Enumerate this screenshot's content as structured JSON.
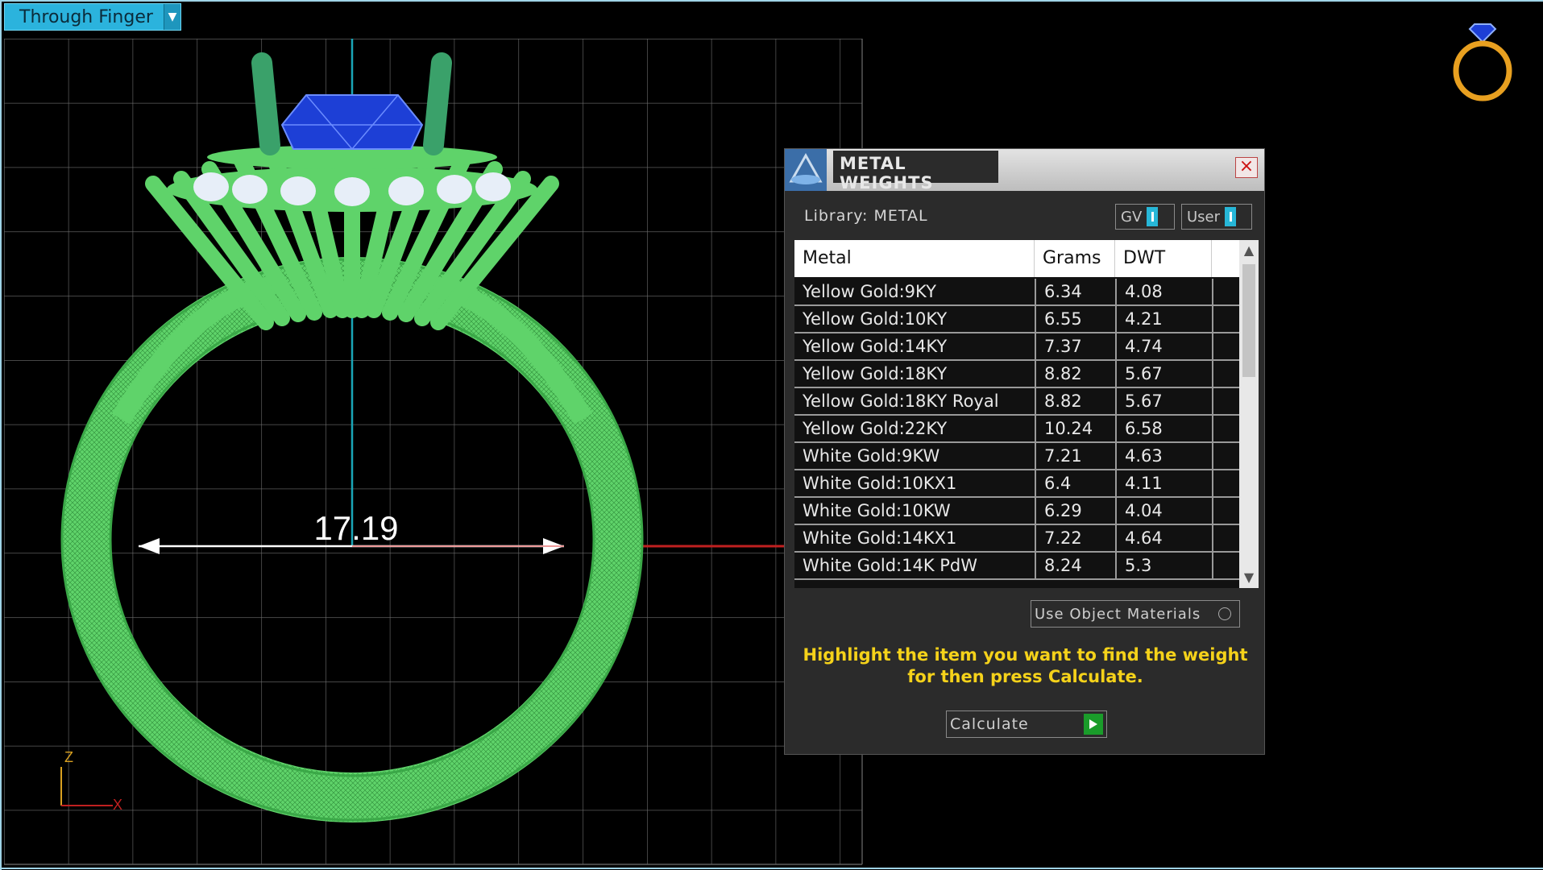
{
  "view": {
    "mode_label": "Through Finger",
    "measurement": "17.19",
    "axis_z": "Z",
    "axis_x": "X"
  },
  "panel": {
    "title": "METAL WEIGHTS",
    "library_label": "Library: METAL",
    "toggle_gv": "GV",
    "toggle_user": "User",
    "columns": [
      "Metal",
      "Grams",
      "DWT"
    ],
    "rows": [
      {
        "metal": "Yellow Gold:9KY",
        "grams": "6.34",
        "dwt": "4.08"
      },
      {
        "metal": "Yellow Gold:10KY",
        "grams": "6.55",
        "dwt": "4.21"
      },
      {
        "metal": "Yellow Gold:14KY",
        "grams": "7.37",
        "dwt": "4.74"
      },
      {
        "metal": "Yellow Gold:18KY",
        "grams": "8.82",
        "dwt": "5.67"
      },
      {
        "metal": "Yellow Gold:18KY Royal",
        "grams": "8.82",
        "dwt": "5.67"
      },
      {
        "metal": "Yellow Gold:22KY",
        "grams": "10.24",
        "dwt": "6.58"
      },
      {
        "metal": "White Gold:9KW",
        "grams": "7.21",
        "dwt": "4.63"
      },
      {
        "metal": "White Gold:10KX1",
        "grams": "6.4",
        "dwt": "4.11"
      },
      {
        "metal": "White Gold:10KW",
        "grams": "6.29",
        "dwt": "4.04"
      },
      {
        "metal": "White Gold:14KX1",
        "grams": "7.22",
        "dwt": "4.64"
      },
      {
        "metal": "White Gold:14K PdW",
        "grams": "8.24",
        "dwt": "5.3"
      }
    ],
    "use_object_materials": "Use Object Materials",
    "hint": "Highlight the item you want to find the weight for then press Calculate.",
    "calculate_label": "Calculate"
  },
  "colors": {
    "ring_wire": "#5fd36a",
    "gem": "#1d3fd6",
    "hint": "#f5d21a",
    "accent": "#27b7d8"
  }
}
